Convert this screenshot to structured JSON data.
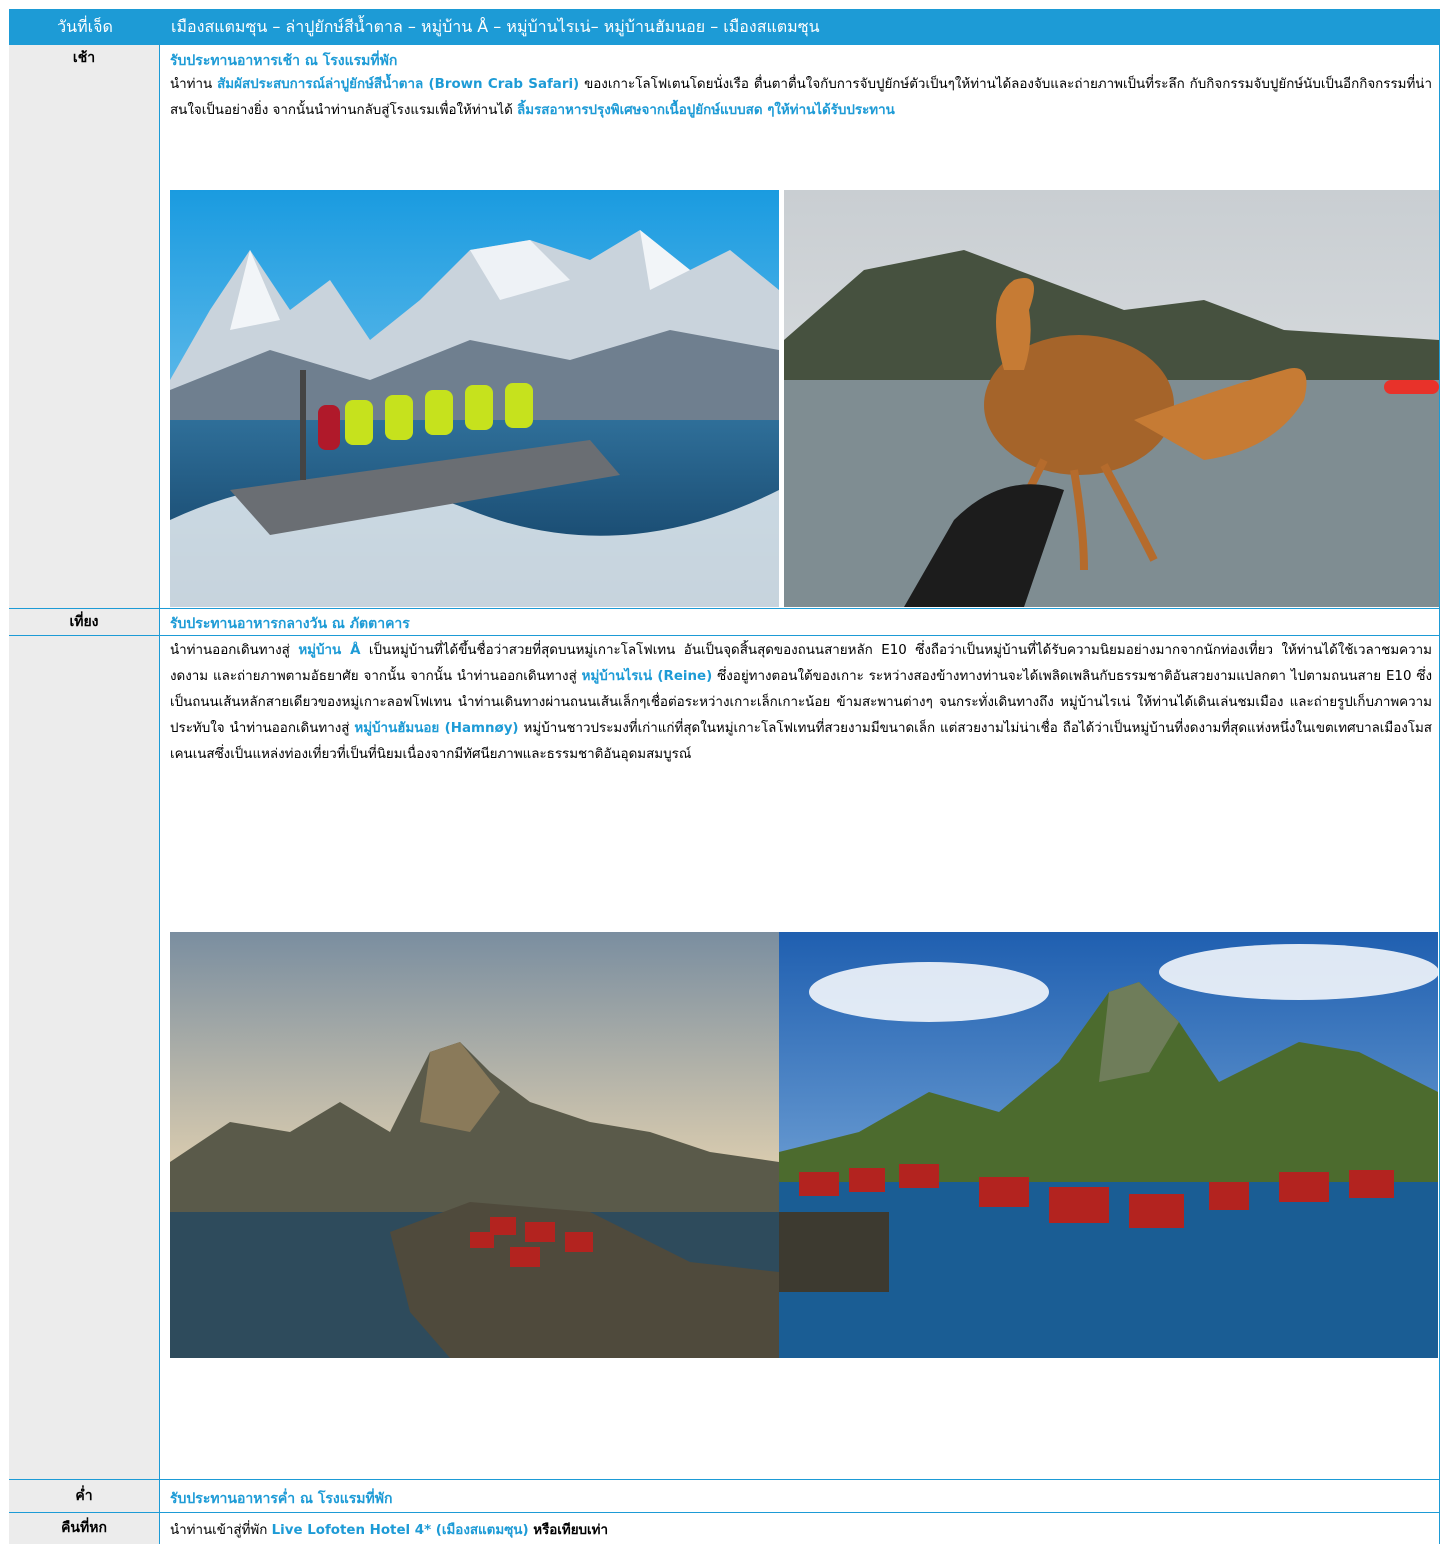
{
  "header": {
    "day": "วันที่เจ็ด",
    "title": "เมืองสแตมซุน – ล่าปูยักษ์สีน้ำตาล – หมู่บ้าน Å – หมู่บ้านไรเน่– หมู่บ้านฮัมนอย – เมืองสแตมซุน"
  },
  "morning": {
    "label": "เช้า",
    "meal": "รับประทานอาหารเช้า ณ โรงแรมที่พัก",
    "p1": "นำท่าน ",
    "hl1": "สัมผัสประสบการณ์ล่าปูยักษ์สีน้ำตาล (Brown Crab Safari)",
    "p2": "  ของเกาะโลโฟเตนโดยนั่งเรือ ตื่นตาตื่นใจกับการจับปูยักษ์ตัวเป็นๆให้ท่านได้ลองจับและถ่ายภาพเป็นที่ระลึก กับกิจกรรมจับปูยักษ์นับเป็นอีกกิจกรรมที่น่าสนใจเป็นอย่างยิ่ง จากนั้นนำท่านกลับสู่โรงแรมเพื่อให้ท่านได้ ",
    "hl2": "ลิ้มรสอาหารปรุงพิเศษจากเนื้อปูยักษ์แบบสด ๆให้ท่านได้รับประทาน"
  },
  "noon": {
    "label": "เที่ยง",
    "meal": "รับประทานอาหารกลางวัน ณ ภัตตาคาร"
  },
  "afternoon": {
    "t1": "นำท่านออกเดินทางสู่  ",
    "hl1": "หมู่บ้าน Å",
    "t2": " เป็นหมู่บ้านที่ได้ขึ้นชื่อว่าสวยที่สุดบนหมู่เกาะโลโฟเทน อันเป็นจุดสิ้นสุดของถนนสายหลัก E10 ซึ่งถือว่าเป็นหมู่บ้านที่ได้รับความนิยมอย่างมากจากนักท่องเที่ยว ให้ท่านได้ใช้เวลาชมความงดงาม และถ่ายภาพตามอัธยาศัย จากนั้น จากนั้น นำท่านออกเดินทางสู่ ",
    "hl2": "หมู่บ้านไรเน่ (Reine)",
    "t3": " ซึ่งอยู่ทางตอนใต้ของเกาะ ระหว่างสองข้างทางท่านจะได้เพลิดเพลินกับธรรมชาติอันสวยงามแปลกตา ไปตามถนนสาย E10 ซึ่งเป็นถนนเส้นหลักสายเดียวของหมู่เกาะลอฟโฟเทน นำท่านเดินทางผ่านถนนเส้นเล็กๆเชื่อต่อระหว่างเกาะเล็กเกาะน้อย ข้ามสะพานต่างๆ จนกระทั่งเดินทางถึง หมู่บ้านไรเน่ ให้ท่านได้เดินเล่นชมเมือง และถ่ายรูปเก็บภาพความประทับใจ นำท่านออกเดินทางสู่ ",
    "hl3": "หมู่บ้านฮัมนอย (Hamnøy)",
    "t4": " หมู่บ้านชาวประมงที่เก่าแก่ที่สุดในหมู่เกาะโลโฟเทนที่สวยงามมีขนาดเล็ก แต่สวยงามไม่น่าเชื่อ ถือได้ว่าเป็นหมู่บ้านที่งดงามที่สุดแห่งหนึ่งในเขตเทศบาลเมืองโมสเคนเนสซึ่งเป็นแหล่งท่องเที่ยวที่เป็นที่นิยมเนื่องจากมีทัศนียภาพและธรรมชาติอันอุดมสมบูรณ์"
  },
  "evening": {
    "label": "ค่ำ",
    "meal": "รับประทานอาหารค่ำ ณ โรงแรมที่พัก"
  },
  "night": {
    "label": "คืนที่หก",
    "t1": "นำท่านเข้าสู่ที่พัก ",
    "hl": "Live Lofoten Hotel 4* (เมืองสแตมซุน)",
    "t2": " หรือเทียบเท่า"
  },
  "colors": {
    "accent": "#1d9bd6",
    "label_bg": "#ececec"
  }
}
